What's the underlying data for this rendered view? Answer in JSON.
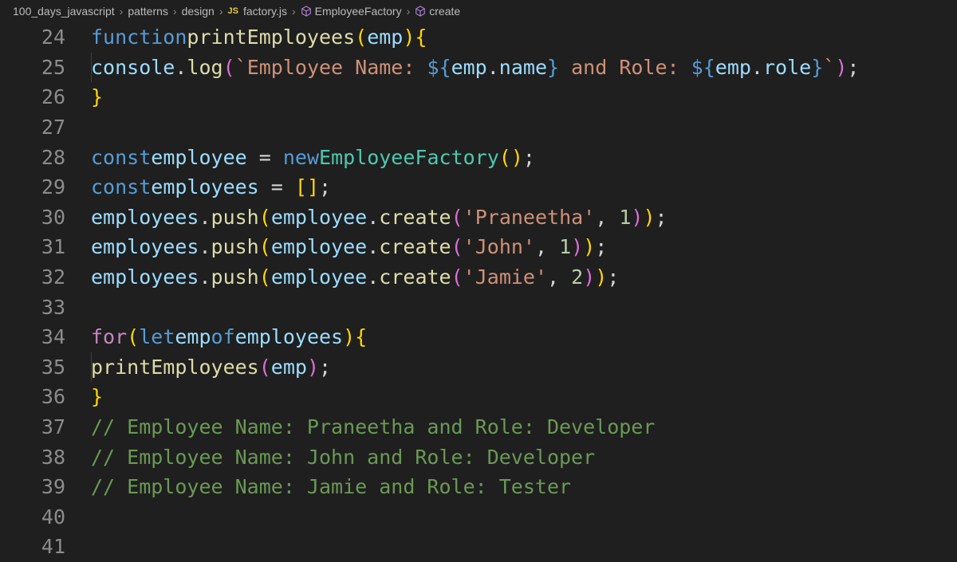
{
  "breadcrumb": {
    "items": [
      "100_days_javascript",
      "patterns",
      "design",
      "factory.js",
      "EmployeeFactory",
      "create"
    ],
    "file_badge": "JS"
  },
  "line_numbers": [
    "24",
    "25",
    "26",
    "27",
    "28",
    "29",
    "30",
    "31",
    "32",
    "33",
    "34",
    "35",
    "36",
    "37",
    "38",
    "39",
    "40",
    "41"
  ],
  "code": {
    "l24": {
      "kw": "function",
      "fn": "printEmployees",
      "p": "(",
      "param": "emp",
      "p2": ")",
      "brace": "{"
    },
    "l25": {
      "obj": "console",
      "dot": ".",
      "fn": "log",
      "p": "(",
      "s1": "`Employee Name: ",
      "t1o": "${",
      "e1a": "emp",
      "e1d": ".",
      "e1b": "name",
      "t1c": "}",
      "s2": " and Role: ",
      "t2o": "${",
      "e2a": "emp",
      "e2d": ".",
      "e2b": "role",
      "t2c": "}",
      "s3": "`",
      "p2": ")",
      "semi": ";"
    },
    "l26": {
      "brace": "}"
    },
    "l28": {
      "kw": "const",
      "var": "employee",
      "eq": " = ",
      "new": "new",
      "cls": "EmployeeFactory",
      "p": "()",
      "semi": ";"
    },
    "l29": {
      "kw": "const",
      "var": "employees",
      "eq": " = ",
      "br": "[]",
      "semi": ";"
    },
    "l30": {
      "a": "employees",
      "d1": ".",
      "push": "push",
      "p": "(",
      "b": "employee",
      "d2": ".",
      "create": "create",
      "p2": "(",
      "str": "'Praneetha'",
      "comma": ", ",
      "num": "1",
      "p3": ")",
      "p4": ")",
      "semi": ";"
    },
    "l31": {
      "a": "employees",
      "d1": ".",
      "push": "push",
      "p": "(",
      "b": "employee",
      "d2": ".",
      "create": "create",
      "p2": "(",
      "str": "'John'",
      "comma": ", ",
      "num": "1",
      "p3": ")",
      "p4": ")",
      "semi": ";"
    },
    "l32": {
      "a": "employees",
      "d1": ".",
      "push": "push",
      "p": "(",
      "b": "employee",
      "d2": ".",
      "create": "create",
      "p2": "(",
      "str": "'Jamie'",
      "comma": ", ",
      "num": "2",
      "p3": ")",
      "p4": ")",
      "semi": ";"
    },
    "l34": {
      "for": "for",
      "p": "(",
      "let": "let",
      "v": "emp",
      "of": "of",
      "coll": "employees",
      "p2": ")",
      "brace": "{"
    },
    "l35": {
      "fn": "printEmployees",
      "p": "(",
      "arg": "emp",
      "p2": ")",
      "semi": ";"
    },
    "l36": {
      "brace": "}"
    },
    "l37": {
      "cmt": "// Employee Name: Praneetha and Role: Developer"
    },
    "l38": {
      "cmt": "// Employee Name: John and Role: Developer"
    },
    "l39": {
      "cmt": "// Employee Name: Jamie and Role: Tester"
    }
  },
  "colors": {
    "background": "#1f1f1f",
    "keyword": "#569cd6",
    "function": "#dcdcaa",
    "variable": "#9cdcfe",
    "class": "#4ec9b0",
    "string": "#ce9178",
    "number": "#b5cea8",
    "comment": "#6a9955"
  },
  "icons": {
    "chevron": "chevron-right-icon",
    "symbol": "cube-icon"
  }
}
